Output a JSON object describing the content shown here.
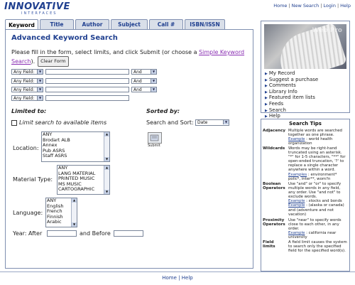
{
  "header": {
    "logo": "INNOVATIVE",
    "logo_sub": "INTERFACES",
    "links": [
      "Home",
      "New Search",
      "Login",
      "Help"
    ]
  },
  "tabs": [
    "Keyword",
    "Title",
    "Author",
    "Subject",
    "Call #",
    "ISBN/ISSN"
  ],
  "main": {
    "title": "Advanced Keyword Search",
    "intro_text": "Please fill in the form, select limits, and click Submit (or choose a ",
    "intro_link": "Simple Keyword Search",
    "intro_end": ").",
    "clear_button": "Clear Form",
    "field_select": "Any Field:",
    "bool_select": "And",
    "limited_to": "Limited to:",
    "limit_check_label": "Limit search to available items",
    "location_label": "Location:",
    "location_options": [
      "ANY",
      "Brodart ALB",
      "Annex",
      "Pub ASRS",
      "Staff ASRS"
    ],
    "material_label": "Material Type:",
    "material_options": [
      "ANY",
      "LANG MATERIAL",
      "PRINTED MUSIC",
      "MS MUSIC",
      "CARTOGRAPHIC"
    ],
    "language_label": "Language:",
    "language_options": [
      "ANY",
      "English",
      "French",
      "Finnish",
      "Arabic"
    ],
    "year_after": "Year: After",
    "year_before": "and Before",
    "sorted_by": "Sorted by:",
    "sort_label": "Search and Sort:",
    "sort_value": "Date",
    "submit_label": "Submit"
  },
  "sidebar": {
    "watermark": "Web Pro",
    "links": [
      "My Record",
      "Suggest a purchase",
      "Comments",
      "Library Info",
      "Featured item lists",
      "Feeds",
      "Search",
      "Help"
    ]
  },
  "tips": {
    "title": "Search Tips",
    "rows": [
      {
        "term": "Adjacency",
        "text": "Multiple words are searched together as one phrase.",
        "example_label": "Example",
        "example": " : world health organization"
      },
      {
        "term": "Wildcards",
        "text": "Words may be right-hand truncated using an asterisk. \"*\" for 1-5 characters, \"**\" for open-ended truncation, '?' to replace a single character anywhere within a word.",
        "example_label": "Examples",
        "example": " : environment* polic*, inter**, wom?n"
      },
      {
        "term": "Boolean Operators",
        "text": "Use \"and\" or \"or\" to specify multiple words in any field, any order. Use \"and not\" to exclude words.",
        "example_label": "Example",
        "example": " : stocks and bonds",
        "example2_label": "Example",
        "example2": " : (alaska or canada) and (adventure and not vacation)"
      },
      {
        "term": "Proximity Operators",
        "text": "Use \"near\" to specify words close to each other, in any order.",
        "example_label": "Example",
        "example": " : california near university"
      },
      {
        "term": "Field limits",
        "text": "A field limit causes the system to search only the specified field for the specified word(s)."
      }
    ]
  },
  "footer": {
    "links": [
      "Home",
      "Help"
    ]
  }
}
